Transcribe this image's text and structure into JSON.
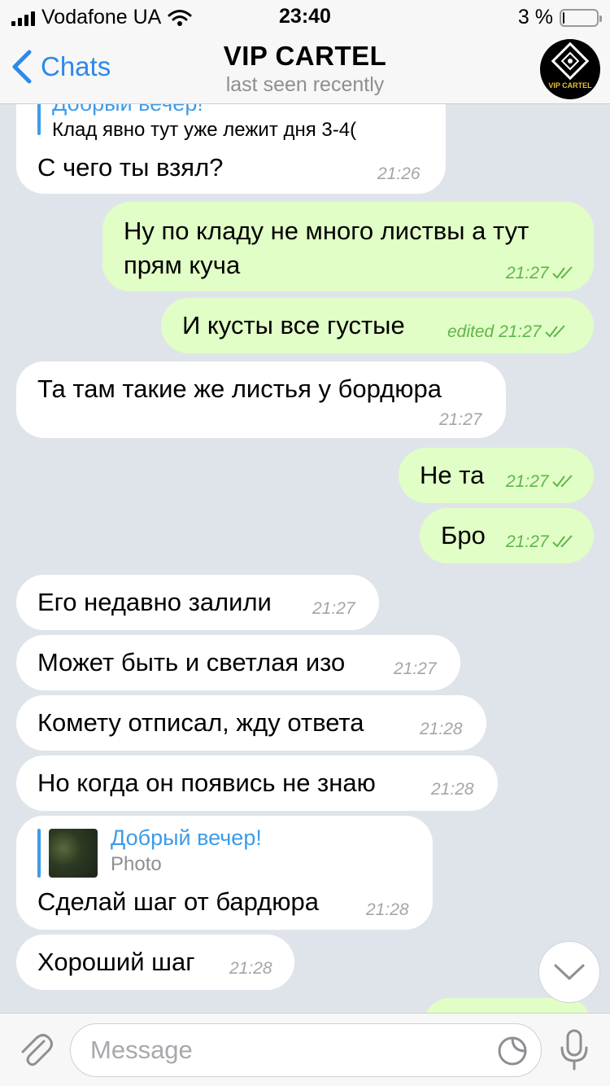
{
  "status_bar": {
    "carrier": "Vodafone UA",
    "time": "23:40",
    "battery_text": "3 %",
    "battery_level": 0.03
  },
  "nav": {
    "back_label": "Chats",
    "title": "VIP CARTEL",
    "subtitle": "last seen recently",
    "avatar_text": "VIP CARTEL"
  },
  "messages": [
    {
      "dir": "in",
      "reply_name": "Добрый вечер!",
      "reply_text": "Клад явно тут уже лежит дня 3-4(",
      "text": "С чего ты взял?",
      "time": "21:26"
    },
    {
      "dir": "out",
      "lines": [
        "Ну по кладу не много листвы а тут",
        "прям куча"
      ],
      "time": "21:27"
    },
    {
      "dir": "out",
      "text": "И кусты все густые",
      "edited": "edited",
      "time": "21:27"
    },
    {
      "dir": "in",
      "text": "Та там такие же листья у бордюра",
      "time": "21:27"
    },
    {
      "dir": "out",
      "text": "Не та",
      "time": "21:27"
    },
    {
      "dir": "out",
      "text": "Бро",
      "time": "21:27"
    },
    {
      "dir": "in",
      "text": "Его недавно залили",
      "time": "21:27"
    },
    {
      "dir": "in",
      "text": "Может быть и светлая изо",
      "time": "21:27"
    },
    {
      "dir": "in",
      "text": "Комету отписал, жду ответа",
      "time": "21:28"
    },
    {
      "dir": "in",
      "text": "Но когда он появись не знаю",
      "time": "21:28"
    },
    {
      "dir": "in",
      "reply_name": "Добрый вечер!",
      "reply_text": "Photo",
      "text": "Сделай шаг от бардюра",
      "time": "21:28"
    },
    {
      "dir": "in",
      "text": "Хороший шаг",
      "time": "21:28"
    }
  ],
  "input": {
    "placeholder": "Message"
  },
  "colors": {
    "accent": "#2c8ae8",
    "outgoing_bubble": "#e1fec6",
    "incoming_bubble": "#ffffff",
    "outgoing_time": "#5fb64a",
    "chat_background": "#dfe4ea"
  },
  "icons": [
    "wifi-icon",
    "back-chevron-icon",
    "checkmarks-icon",
    "paperclip-icon",
    "sticker-icon",
    "microphone-icon",
    "chevron-down-icon"
  ]
}
